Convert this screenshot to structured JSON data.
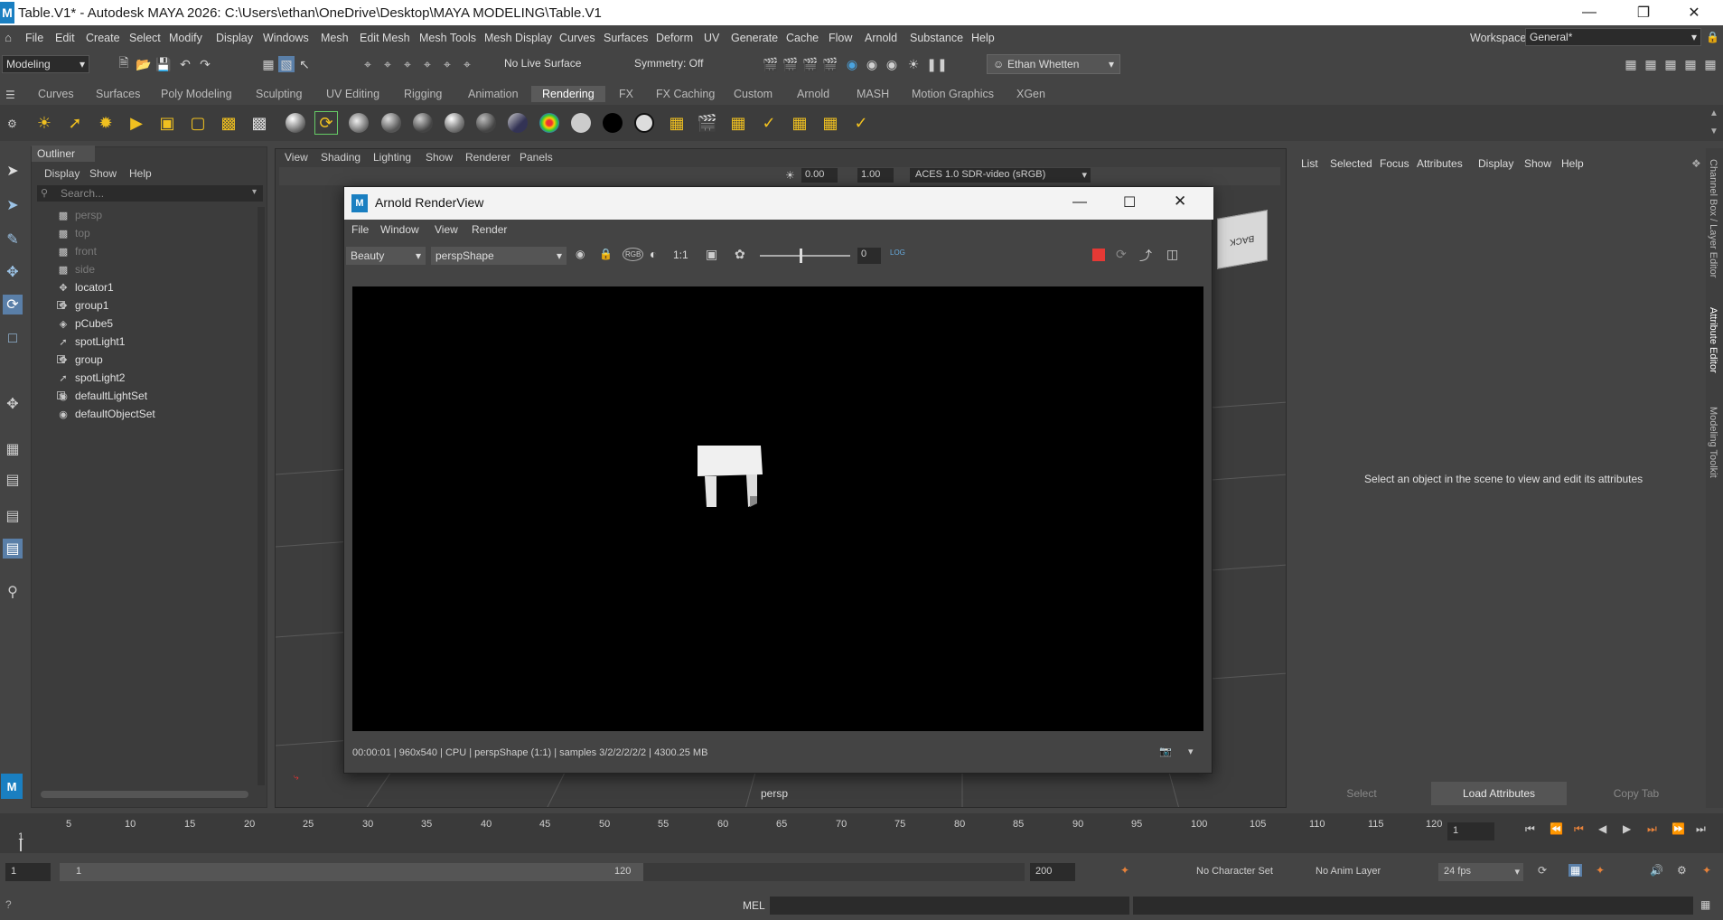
{
  "window": {
    "title": "Table.V1* - Autodesk MAYA 2026: C:\\Users\\ethan\\OneDrive\\Desktop\\MAYA MODELING\\Table.V1",
    "logo": "M"
  },
  "menubar": {
    "items": [
      "File",
      "Edit",
      "Create",
      "Select",
      "Modify",
      "Display",
      "Windows",
      "Mesh",
      "Edit Mesh",
      "Mesh Tools",
      "Mesh Display",
      "Curves",
      "Surfaces",
      "Deform",
      "UV",
      "Generate",
      "Cache",
      "Flow",
      "Arnold",
      "Substance",
      "Help"
    ],
    "workspace_label": "Workspace:",
    "workspace_value": "General*"
  },
  "toolrow": {
    "mode": "Modeling",
    "live_surface": "No Live Surface",
    "symmetry": "Symmetry: Off",
    "user": "Ethan Whetten"
  },
  "shelf": {
    "tabs": [
      "Curves",
      "Surfaces",
      "Poly Modeling",
      "Sculpting",
      "UV Editing",
      "Rigging",
      "Animation",
      "Rendering",
      "FX",
      "FX Caching",
      "Custom",
      "Arnold",
      "MASH",
      "Motion Graphics",
      "XGen"
    ],
    "active_tab": "Rendering"
  },
  "outliner": {
    "title": "Outliner",
    "menu": [
      "Display",
      "Show",
      "Help"
    ],
    "search_placeholder": "Search...",
    "items": [
      {
        "label": "persp",
        "dim": true,
        "icon": "camera-icon"
      },
      {
        "label": "top",
        "dim": true,
        "icon": "camera-icon"
      },
      {
        "label": "front",
        "dim": true,
        "icon": "camera-icon"
      },
      {
        "label": "side",
        "dim": true,
        "icon": "camera-icon"
      },
      {
        "label": "locator1",
        "dim": false,
        "icon": "transform-icon"
      },
      {
        "label": "group1",
        "dim": false,
        "icon": "transform-icon",
        "expand": true
      },
      {
        "label": "pCube5",
        "dim": false,
        "icon": "mesh-icon"
      },
      {
        "label": "spotLight1",
        "dim": false,
        "icon": "spotlight-icon"
      },
      {
        "label": "group",
        "dim": false,
        "icon": "transform-icon",
        "expand": true
      },
      {
        "label": "spotLight2",
        "dim": false,
        "icon": "spotlight-icon"
      },
      {
        "label": "defaultLightSet",
        "dim": false,
        "icon": "set-icon",
        "expand": true
      },
      {
        "label": "defaultObjectSet",
        "dim": false,
        "icon": "set-icon"
      }
    ]
  },
  "viewport": {
    "menu": [
      "View",
      "Shading",
      "Lighting",
      "Show",
      "Renderer",
      "Panels"
    ],
    "exposure": "0.00",
    "gamma": "1.00",
    "color_space": "ACES 1.0 SDR-video (sRGB)",
    "camera_label": "persp",
    "viewcube_face": "BACK"
  },
  "renderview": {
    "title": "Arnold RenderView",
    "menu": [
      "File",
      "Window",
      "View",
      "Render"
    ],
    "aov": "Beauty",
    "camera": "perspShape",
    "ratio": "1:1",
    "rgb_label": "RGB",
    "slider_value": "0",
    "log_label": "LOG",
    "status": "00:00:01 | 960x540 | CPU | perspShape (1:1) | samples 3/2/2/2/2/2 | 4300.25 MB"
  },
  "attribute_editor": {
    "menu": [
      "List",
      "Selected",
      "Focus",
      "Attributes",
      "Display",
      "Show",
      "Help"
    ],
    "message": "Select an object in the scene to view and edit its attributes",
    "buttons": [
      "Select",
      "Load Attributes",
      "Copy Tab"
    ],
    "side_tabs": [
      "Channel Box / Layer Editor",
      "Attribute Editor",
      "Modeling Toolkit"
    ]
  },
  "timeline": {
    "ticks": [
      "5",
      "10",
      "15",
      "20",
      "25",
      "30",
      "35",
      "40",
      "45",
      "50",
      "55",
      "60",
      "65",
      "70",
      "75",
      "80",
      "85",
      "90",
      "95",
      "100",
      "105",
      "110",
      "115",
      "120"
    ],
    "start_marker": "1",
    "current_frame": "1"
  },
  "range": {
    "start": "1",
    "inner_start": "1",
    "inner_end": "120",
    "end": "200",
    "character_set": "No Character Set",
    "anim_layer": "No Anim Layer",
    "fps": "24 fps"
  },
  "cmdline": {
    "label": "MEL"
  }
}
